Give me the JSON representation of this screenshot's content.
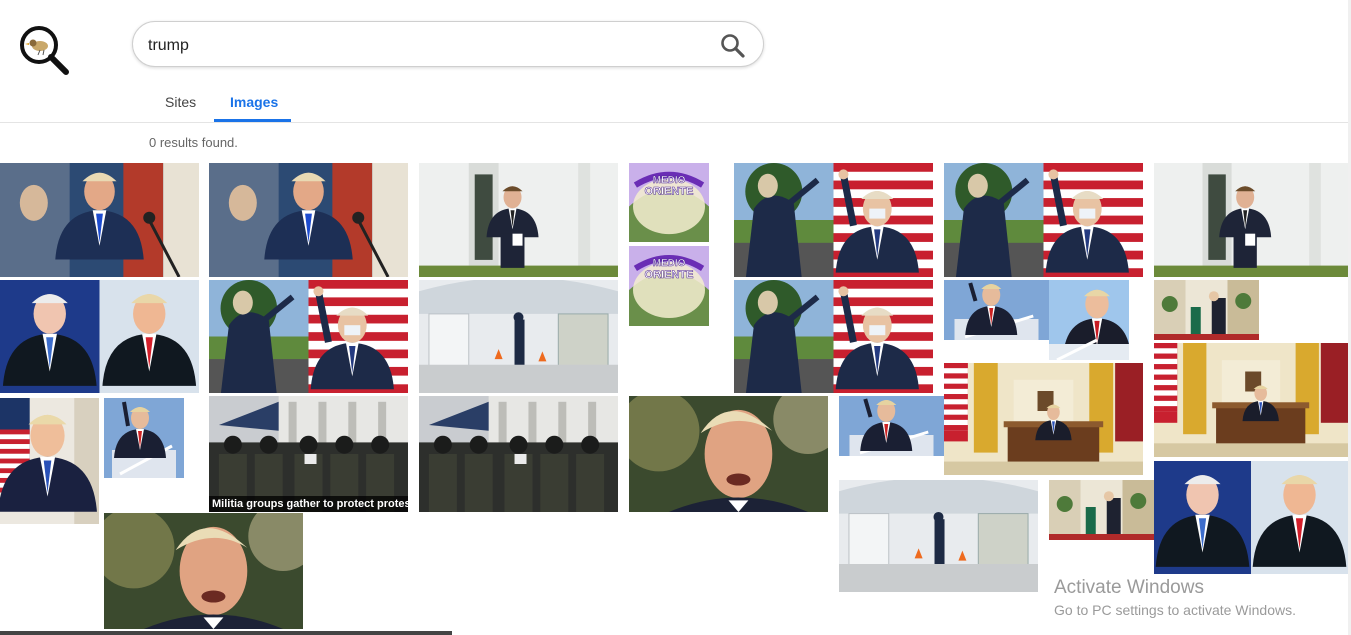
{
  "search": {
    "query": "trump"
  },
  "tabs": [
    {
      "label": "Sites"
    },
    {
      "label": "Images"
    }
  ],
  "results": {
    "count_text": "0 results found."
  },
  "tiles": [
    {
      "kind": "portrait_blue",
      "caption": ""
    },
    {
      "kind": "portrait_blue",
      "caption": ""
    },
    {
      "kind": "white_house_man",
      "caption": ""
    },
    {
      "kind": "medio_oriente",
      "caption": ""
    },
    {
      "kind": "medio_oriente",
      "caption": ""
    },
    {
      "kind": "wave_flag",
      "caption": ""
    },
    {
      "kind": "wave_flag",
      "caption": ""
    },
    {
      "kind": "white_house_man",
      "caption": ""
    },
    {
      "kind": "biden_trump",
      "caption": ""
    },
    {
      "kind": "wave_flag",
      "caption": ""
    },
    {
      "kind": "tent_hospital",
      "caption": ""
    },
    {
      "kind": "wave_flag",
      "caption": ""
    },
    {
      "kind": "plane_stairs",
      "caption": ""
    },
    {
      "kind": "trump_red_tie",
      "caption": ""
    },
    {
      "kind": "interior_room",
      "caption": ""
    },
    {
      "kind": "trump_flag_smile",
      "caption": ""
    },
    {
      "kind": "plane_stairs",
      "caption": ""
    },
    {
      "kind": "militia",
      "caption": "Militia groups gather to protect protesters"
    },
    {
      "kind": "militia",
      "caption": ""
    },
    {
      "kind": "trump_closeup",
      "caption": ""
    },
    {
      "kind": "plane_stairs",
      "caption": ""
    },
    {
      "kind": "oval_office",
      "caption": ""
    },
    {
      "kind": "oval_office",
      "caption": ""
    },
    {
      "kind": "trump_closeup",
      "caption": ""
    },
    {
      "kind": "tent_hospital",
      "caption": ""
    },
    {
      "kind": "interior_room",
      "caption": ""
    },
    {
      "kind": "biden_trump",
      "caption": ""
    }
  ],
  "medio_oriente_text": [
    "MEDIO",
    "ORIENTE"
  ],
  "watermark": {
    "title": "Activate Windows",
    "subtitle": "Go to PC settings to activate Windows."
  },
  "colors": {
    "accent": "#1a73e8",
    "text_muted": "#666666"
  },
  "icons": {
    "logo": "magnifier-bird-logo-icon",
    "search": "search-icon"
  }
}
